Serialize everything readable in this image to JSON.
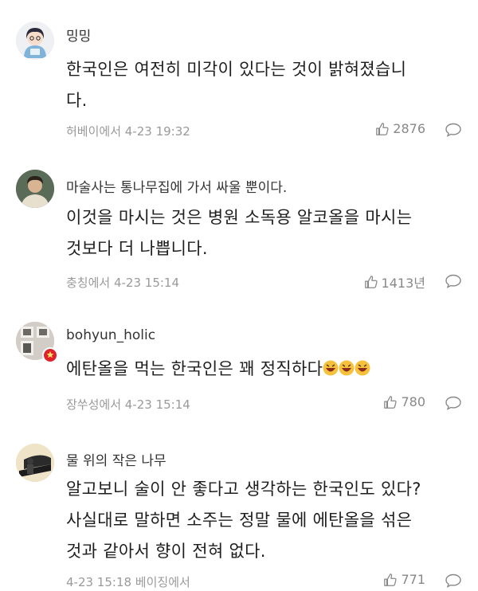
{
  "comments": [
    {
      "username": "밍밍",
      "lines": [
        "한국인은 여전히 미각이 있다는 것이 밝혀졌습니",
        "다."
      ],
      "meta": "허베이에서 4-23 19:32",
      "likes": "2876"
    },
    {
      "username": "마술사는 통나무집에 가서 싸울 뿐이다.",
      "lines": [
        "이것을 마시는 것은 병원 소독용 알코올을 마시는",
        "것보다 더 나쁩니다."
      ],
      "meta": "충칭에서 4-23 15:14",
      "likes": "1413년"
    },
    {
      "username": "bohyun_holic",
      "lines": [
        "에탄올을 먹는 한국인은 꽤 정직하다"
      ],
      "meta": "장쑤성에서 4-23 15:14",
      "likes": "780"
    },
    {
      "username": "물 위의 작은 나무",
      "lines": [
        "알고보니 술이 안 좋다고 생각하는 한국인도 있다?",
        "사실대로 말하면 소주는 정말 물에 에탄올을 섞은",
        "것과 같아서 향이 전혀 없다."
      ],
      "meta": "4-23 15:18 베이징에서",
      "likes": "771"
    }
  ]
}
